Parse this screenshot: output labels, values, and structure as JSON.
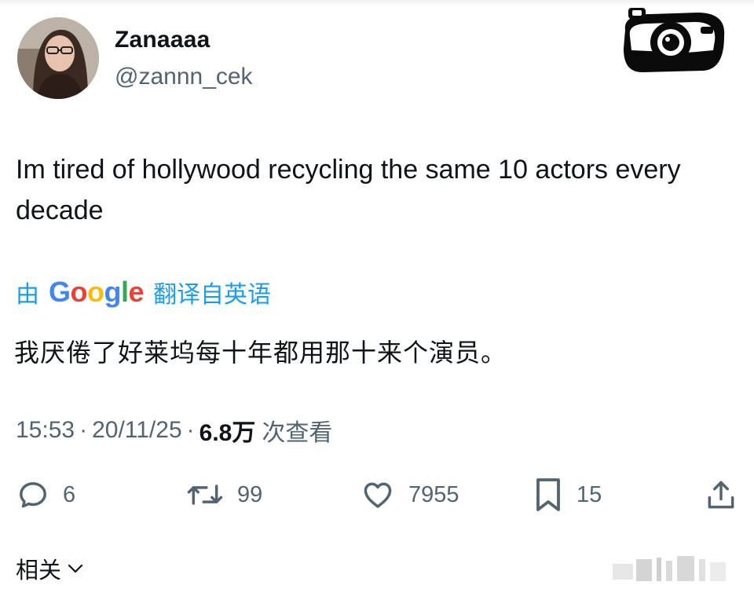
{
  "tweet": {
    "author": {
      "display_name": "Zanaaaa",
      "handle": "@zannn_cek"
    },
    "text": "Im tired of hollywood recycling the same 10 actors every decade",
    "translation": {
      "by_label": "由",
      "provider_letters": [
        "G",
        "o",
        "o",
        "g",
        "l",
        "e"
      ],
      "from_label": "翻译自英语",
      "text": "我厌倦了好莱坞每十年都用那十来个演员。"
    },
    "meta": {
      "time": "15:53",
      "date": "20/11/25",
      "separator": "·",
      "views_count": "6.8万",
      "views_label": "次查看"
    },
    "actions": {
      "replies": "6",
      "reposts": "99",
      "likes": "7955",
      "bookmarks": "15"
    },
    "related_label": "相关"
  },
  "colors": {
    "accent": "#1d9bf0",
    "secondary_text": "#536471",
    "primary_text": "#0f1419",
    "google_blue": "#4285f4",
    "google_red": "#ea4335",
    "google_yellow": "#fbbc05",
    "google_green": "#34a853"
  },
  "icons": {
    "reply": "speech-bubble-icon",
    "repost": "repost-arrows-icon",
    "like": "heart-icon",
    "bookmark": "bookmark-icon",
    "share": "share-upload-icon",
    "related_toggle": "chevron-down-icon",
    "logo": "camera-icon"
  }
}
